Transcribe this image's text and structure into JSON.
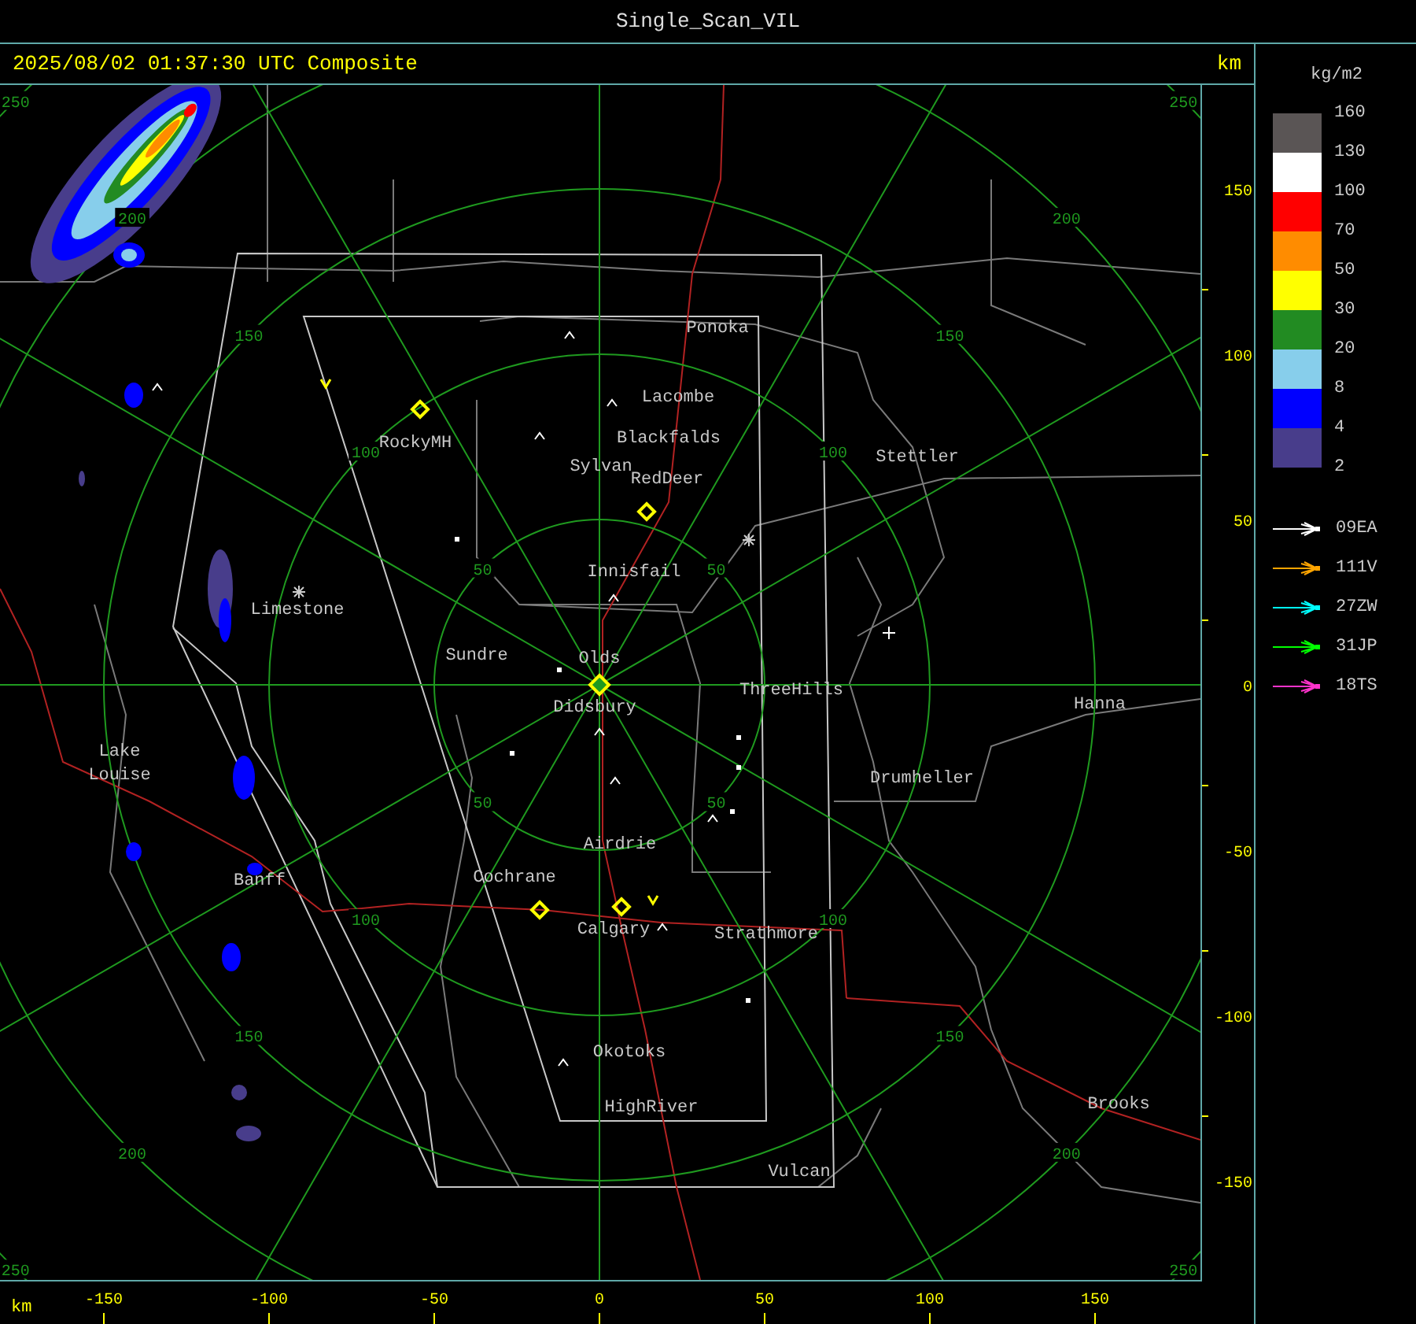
{
  "window": {
    "title": "Single_Scan_VIL"
  },
  "header": {
    "timestamp": "2025/08/02 01:37:30 UTC Composite",
    "unit": "km"
  },
  "map": {
    "range_rings": [
      {
        "labels": [
          "50",
          "50",
          "50",
          "50"
        ]
      },
      {
        "labels": [
          "100",
          "100",
          "100",
          "100"
        ]
      },
      {
        "labels": [
          "150",
          "150",
          "150",
          "150"
        ]
      },
      {
        "labels": [
          "200",
          "200",
          "200",
          "200"
        ]
      },
      {
        "labels": [
          "250",
          "250",
          "250",
          "250"
        ]
      }
    ],
    "cities": [
      {
        "name": "Ponoka"
      },
      {
        "name": "Lacombe"
      },
      {
        "name": "Blackfalds"
      },
      {
        "name": "RockyMH"
      },
      {
        "name": "Stettler"
      },
      {
        "name": "Sylvan"
      },
      {
        "name": "RedDeer"
      },
      {
        "name": "Innisfail"
      },
      {
        "name": "Limestone"
      },
      {
        "name": "Sundre"
      },
      {
        "name": "Olds"
      },
      {
        "name": "ThreeHills"
      },
      {
        "name": "Didsbury"
      },
      {
        "name": "Hanna"
      },
      {
        "name": "Lake Louise"
      },
      {
        "name": "Drumheller"
      },
      {
        "name": "Airdrie"
      },
      {
        "name": "Cochrane"
      },
      {
        "name": "Banff"
      },
      {
        "name": "Calgary"
      },
      {
        "name": "Strathmore"
      },
      {
        "name": "Okotoks"
      },
      {
        "name": "Brooks"
      },
      {
        "name": "HighRiver"
      },
      {
        "name": "Vulcan"
      }
    ]
  },
  "y_axis": {
    "ticks": [
      "150",
      "100",
      "50",
      "0",
      "-50",
      "-100",
      "-150"
    ]
  },
  "x_axis": {
    "unit": "km",
    "ticks": [
      "-150",
      "-100",
      "-50",
      "0",
      "50",
      "100",
      "150"
    ]
  },
  "legend": {
    "unit": "kg/m2",
    "bins": [
      {
        "color": "#5a5555"
      },
      {
        "color": "#ffffff"
      },
      {
        "color": "#ff0000"
      },
      {
        "color": "#ff8c00"
      },
      {
        "color": "#ffff00"
      },
      {
        "color": "#228b22"
      },
      {
        "color": "#87ceeb"
      },
      {
        "color": "#0000ff"
      },
      {
        "color": "#483d8b"
      }
    ],
    "labels": [
      "160",
      "130",
      "100",
      "70",
      "50",
      "30",
      "20",
      "8",
      "4",
      "2"
    ],
    "tracks": [
      {
        "label": "09EA",
        "color": "#ffffff"
      },
      {
        "label": "111V",
        "color": "#ffa500"
      },
      {
        "label": "27ZW",
        "color": "#00ffff"
      },
      {
        "label": "31JP",
        "color": "#00ff00"
      },
      {
        "label": "18TS",
        "color": "#ff33cc"
      }
    ]
  }
}
